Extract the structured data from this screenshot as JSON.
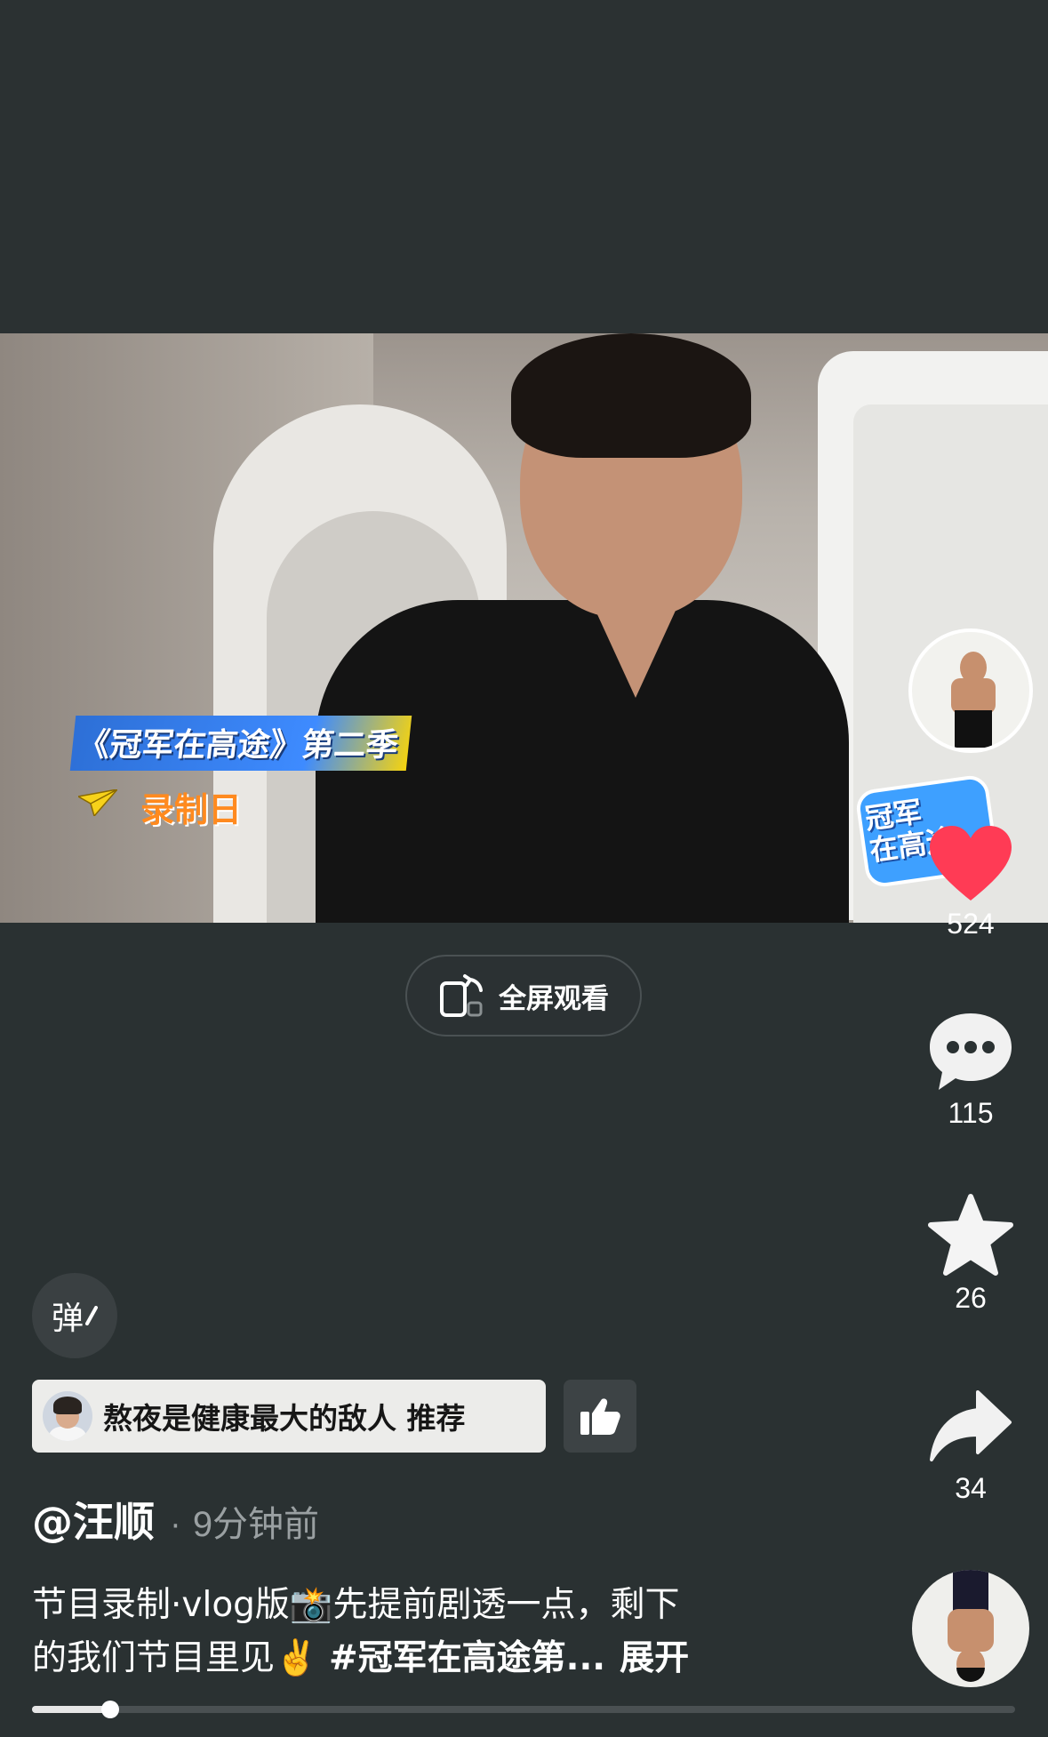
{
  "video": {
    "overlay_title": "《冠军在高途》第二季",
    "overlay_subtitle": "录制日",
    "logo_text_line1": "冠军",
    "logo_text_line2": "在高途"
  },
  "fullscreen": {
    "label": "全屏观看"
  },
  "actions": {
    "like_count": "524",
    "comment_count": "115",
    "favorite_count": "26",
    "share_count": "34"
  },
  "danmu": {
    "label": "弹"
  },
  "recommend": {
    "text": "熬夜是健康最大的敌人 推荐"
  },
  "author": {
    "handle": "@汪顺",
    "separator": "·",
    "time": "9分钟前"
  },
  "description": {
    "line1": "节目录制·vlog版📸先提前剧透一点，剩下",
    "line2": "的我们节目里见✌️ ",
    "hashtag": "#冠军在高途第...",
    "expand": "展开"
  },
  "progress": {
    "fraction": 0.08
  },
  "colors": {
    "heart": "#ff3b55",
    "background": "#2a3132"
  }
}
